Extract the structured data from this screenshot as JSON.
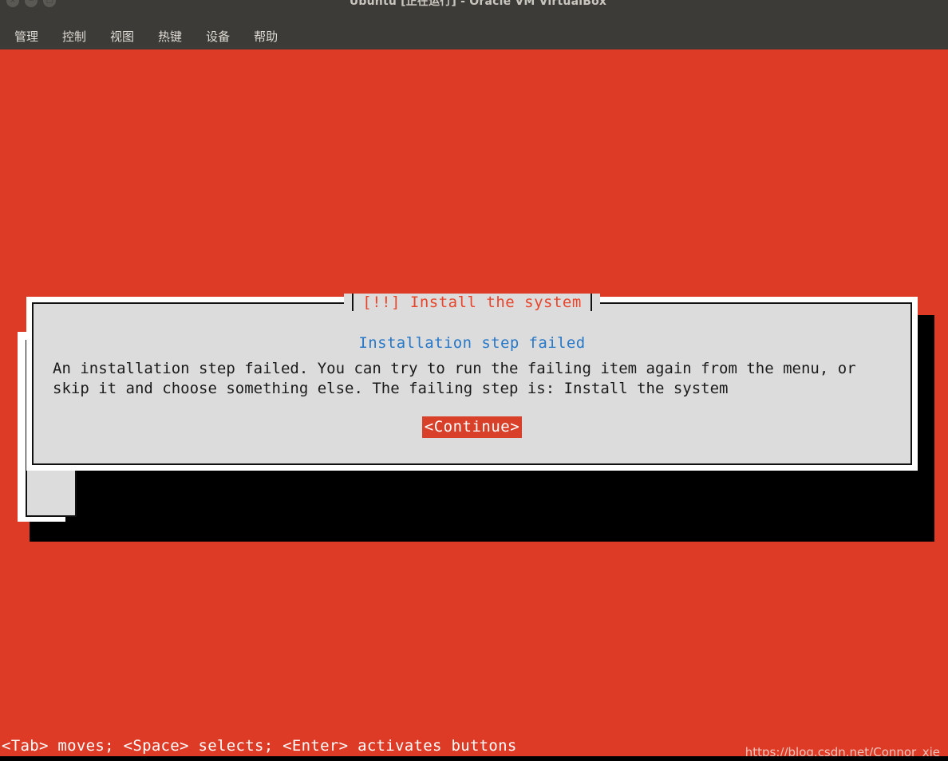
{
  "window": {
    "title": "Ubuntu [正在运行] - Oracle VM VirtualBox",
    "controls": [
      {
        "name": "close",
        "glyph": "×"
      },
      {
        "name": "minimize",
        "glyph": "−"
      },
      {
        "name": "maximize",
        "glyph": "□"
      }
    ],
    "menu": [
      {
        "label": "管理"
      },
      {
        "label": "控制"
      },
      {
        "label": "视图"
      },
      {
        "label": "热键"
      },
      {
        "label": "设备"
      },
      {
        "label": "帮助"
      }
    ]
  },
  "installer": {
    "dialog": {
      "title": "[!!] Install the system",
      "heading": "Installation step failed",
      "body_lines": [
        "An installation step failed. You can try to run the failing item again from the menu, or",
        "skip it and choose something else. The failing step is: Install the system"
      ],
      "button_label": "<Continue>"
    },
    "status_help": "<Tab> moves; <Space> selects; <Enter> activates buttons"
  },
  "watermark": "https://blog.csdn.net/Connor_xie",
  "colors": {
    "background_red": "#dd3b26",
    "dialog_gray": "#dcdcdc",
    "dialog_white": "#ffffff",
    "title_red": "#e8442b",
    "heading_blue": "#2878c8",
    "button_red": "#d8402a",
    "chrome_gray": "#3c3b37",
    "shadow_black": "#000000"
  }
}
